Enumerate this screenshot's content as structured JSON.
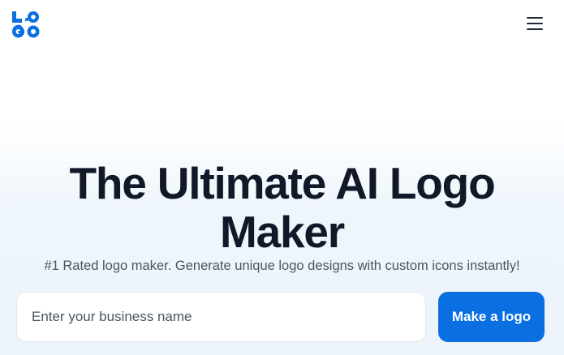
{
  "header": {
    "logo": {
      "icon": "logo-wordmark-icon",
      "text": "LOGO",
      "color": "#0a6fe0"
    },
    "menu_icon": "hamburger-menu-icon"
  },
  "hero": {
    "title": "The Ultimate AI Logo Maker",
    "subtitle": "#1 Rated logo maker. Generate unique logo designs with custom icons instantly!",
    "search": {
      "placeholder": "Enter your business name",
      "value": ""
    },
    "cta_label": "Make a logo"
  },
  "colors": {
    "primary": "#0a6fe0",
    "heading": "#111827",
    "body_text": "#4b5563",
    "background_tint": "#eef5fb"
  }
}
